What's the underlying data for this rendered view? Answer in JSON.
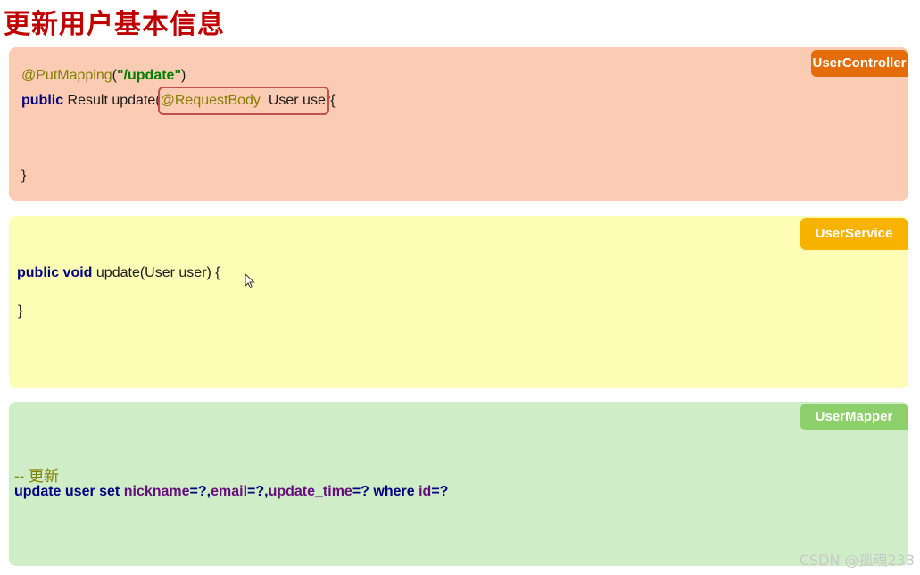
{
  "page": {
    "title": "更新用户基本信息"
  },
  "controller": {
    "tag": "UserController",
    "line1_annotation": "@PutMapping",
    "line1_open": "(",
    "line1_string": "\"/update\"",
    "line1_close": ")",
    "line2_keyword": "public",
    "line2_sig": " Result update(",
    "line2_annotation": "@RequestBody",
    "line2_param": "  User user",
    "line2_end": "{",
    "close_brace": "}"
  },
  "service": {
    "tag": "UserService",
    "line1_keyword": "public void",
    "line1_sig": " update(User user) {",
    "close_brace": "}"
  },
  "mapper": {
    "tag": "UserMapper",
    "comment": "-- 更新",
    "sql_kw1": "update user set",
    "sql_f1": "nickname",
    "sql_p1": "=?,",
    "sql_f2": "email",
    "sql_p2": "=?,",
    "sql_f3": "update_time",
    "sql_p3": "=? ",
    "sql_kw2": "where",
    "sql_f4": " id",
    "sql_p4": "=?"
  },
  "watermark": "CSDN @孤魂233",
  "colors": {
    "title": "#c00000",
    "controller_bg": "#fccbb3",
    "controller_tag": "#e46d0a",
    "service_bg": "#fefdb5",
    "service_tag": "#f8b300",
    "mapper_bg": "#cfeec8",
    "mapper_tag": "#8dcf6a",
    "highlight_border": "#c0504d"
  },
  "icons": {
    "cursor": "mouse-pointer-icon"
  }
}
